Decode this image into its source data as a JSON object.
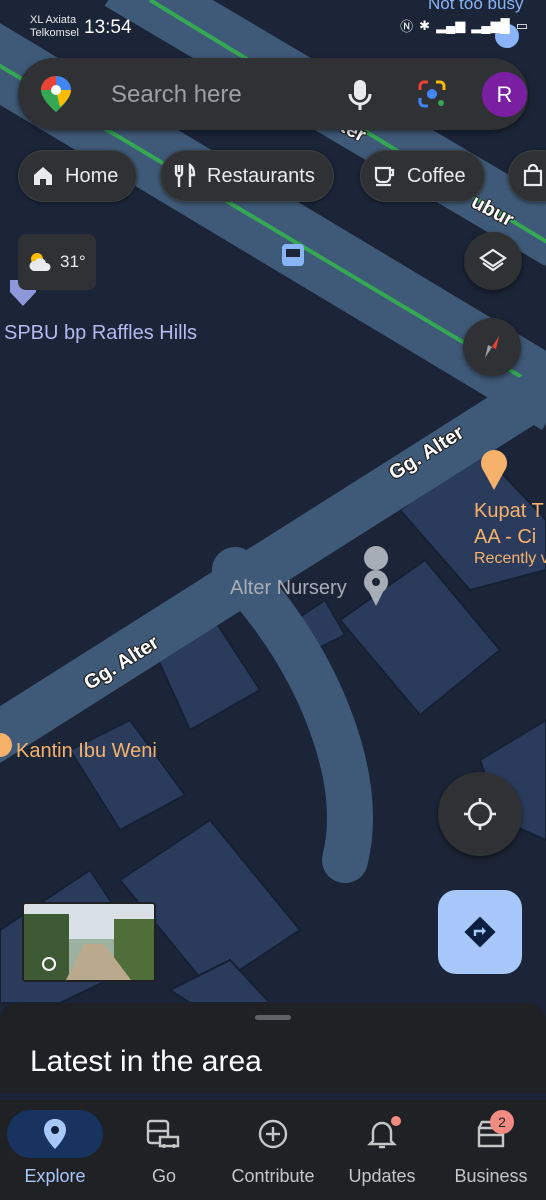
{
  "status_bar": {
    "carrier_1": "XL Axiata",
    "carrier_2": "Telkomsel",
    "time": "13:54",
    "icons": [
      "nfc-icon",
      "bluetooth-icon",
      "signal-icon",
      "4g-signal-icon",
      "battery-icon"
    ]
  },
  "search": {
    "placeholder": "Search here",
    "avatar_letter": "R"
  },
  "chips": [
    {
      "label": "Home",
      "icon": "home-icon"
    },
    {
      "label": "Restaurants",
      "icon": "restaurant-icon"
    },
    {
      "label": "Coffee",
      "icon": "coffee-icon"
    },
    {
      "label": "",
      "icon": "shopping-bag-icon"
    }
  ],
  "weather": {
    "temp": "31°",
    "icon": "partly-cloudy-icon"
  },
  "map": {
    "top_label": "Not too busy",
    "places": {
      "gas_station": "SPBU bp Raffles Hills",
      "nursery": "Alter Nursery",
      "kupat_line1": "Kupat T",
      "kupat_line2": "AA - Ci",
      "kupat_line3": "Recently v",
      "kantin": "Kantin Ibu Weni"
    },
    "roads": {
      "alter_1": "Gg. Alter",
      "alter_2": "Gg. Alter",
      "upper_fragment_1": "ter",
      "upper_fragment_2": "ubur"
    }
  },
  "sheet": {
    "title": "Latest in the area"
  },
  "nav": [
    {
      "label": "Explore",
      "icon": "explore-pin-icon",
      "active": true
    },
    {
      "label": "Go",
      "icon": "go-transit-icon"
    },
    {
      "label": "Contribute",
      "icon": "contribute-plus-icon"
    },
    {
      "label": "Updates",
      "icon": "updates-bell-icon"
    },
    {
      "label": "Business",
      "icon": "business-store-icon",
      "badge": "2"
    }
  ],
  "colors": {
    "map_bg": "#1b2537",
    "road": "#3f5a78",
    "building": "#2a3b5c",
    "traffic_green": "#34a853",
    "accent_blue": "#a8c7fa",
    "place_orange": "#f6b26b",
    "place_purple": "#b4b9f0"
  }
}
